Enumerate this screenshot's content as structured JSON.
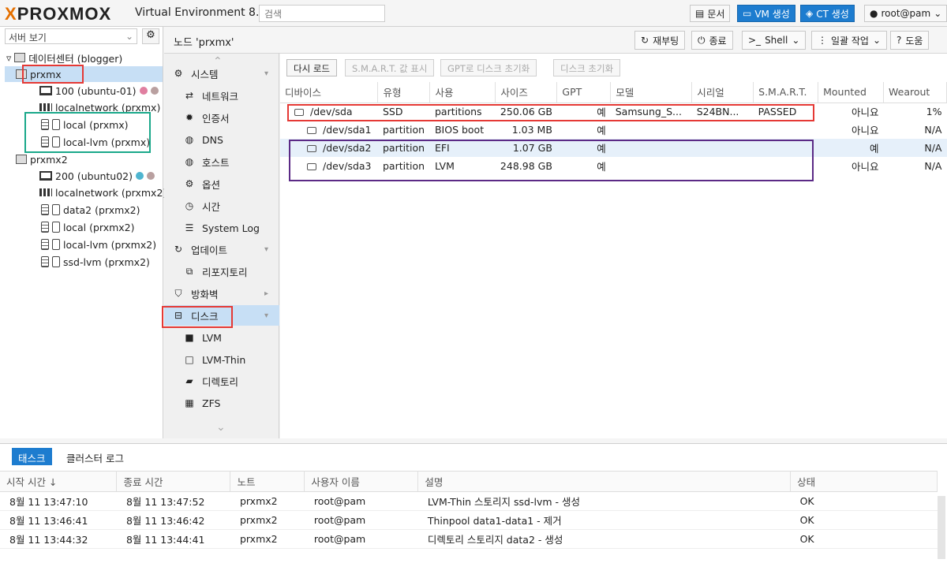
{
  "topbar": {
    "logo": "PROXMOX",
    "version": "Virtual Environment 8.2.2",
    "search_placeholder": "검색",
    "docs": "문서",
    "create_vm": "VM 생성",
    "create_ct": "CT 생성",
    "user": "root@pam"
  },
  "tree": {
    "view": "서버 보기",
    "datacenter": "데이터센터 (blogger)",
    "node1": "prxmx",
    "node1_items": [
      "100 (ubuntu-01)",
      "localnetwork (prxmx)",
      "local (prxmx)",
      "local-lvm (prxmx)"
    ],
    "node2": "prxmx2",
    "node2_items": [
      "200 (ubuntu02)",
      "localnetwork (prxmx2)",
      "data2 (prxmx2)",
      "local (prxmx2)",
      "local-lvm (prxmx2)",
      "ssd-lvm (prxmx2)"
    ]
  },
  "header": {
    "title": "노드 'prxmx'",
    "reboot": "재부팅",
    "shutdown": "종료",
    "shell": "Shell",
    "bulk": "일괄 작업",
    "help": "도움"
  },
  "nav": {
    "items": [
      "시스템",
      "네트워크",
      "인증서",
      "DNS",
      "호스트",
      "옵션",
      "시간",
      "System Log",
      "업데이트",
      "리포지토리",
      "방화벽",
      "디스크",
      "LVM",
      "LVM-Thin",
      "디렉토리",
      "ZFS"
    ]
  },
  "toolbar": {
    "reload": "다시 로드",
    "smart": "S.M.A.R.T. 값 표시",
    "gpt_init": "GPT로 디스크 초기화",
    "wipe": "디스크 초기화"
  },
  "disks": {
    "columns": [
      "디바이스",
      "유형",
      "사용",
      "사이즈",
      "GPT",
      "모델",
      "시리얼",
      "S.M.A.R.T.",
      "Mounted",
      "Wearout"
    ],
    "rows": [
      [
        "/dev/sda",
        "SSD",
        "partitions",
        "250.06 GB",
        "예",
        "Samsung_S...",
        "S24BN...",
        "PASSED",
        "아니요",
        "1%"
      ],
      [
        "/dev/sda1",
        "partition",
        "BIOS boot",
        "1.03 MB",
        "예",
        "",
        "",
        "",
        "아니요",
        "N/A"
      ],
      [
        "/dev/sda2",
        "partition",
        "EFI",
        "1.07 GB",
        "예",
        "",
        "",
        "",
        "예",
        "N/A"
      ],
      [
        "/dev/sda3",
        "partition",
        "LVM",
        "248.98 GB",
        "예",
        "",
        "",
        "",
        "아니요",
        "N/A"
      ]
    ]
  },
  "bottom": {
    "tab_tasks": "태스크",
    "tab_cluster": "클러스터 로그",
    "columns": [
      "시작 시간 ↓",
      "종료 시간",
      "노트",
      "사용자 이름",
      "설명",
      "상태"
    ],
    "rows": [
      [
        "8월 11 13:47:10",
        "8월 11 13:47:52",
        "prxmx2",
        "root@pam",
        "LVM-Thin 스토리지 ssd-lvm - 생성",
        "OK"
      ],
      [
        "8월 11 13:46:41",
        "8월 11 13:46:42",
        "prxmx2",
        "root@pam",
        "Thinpool data1-data1 - 제거",
        "OK"
      ],
      [
        "8월 11 13:44:32",
        "8월 11 13:44:41",
        "prxmx2",
        "root@pam",
        "디렉토리 스토리지 data2 - 생성",
        "OK"
      ]
    ]
  }
}
